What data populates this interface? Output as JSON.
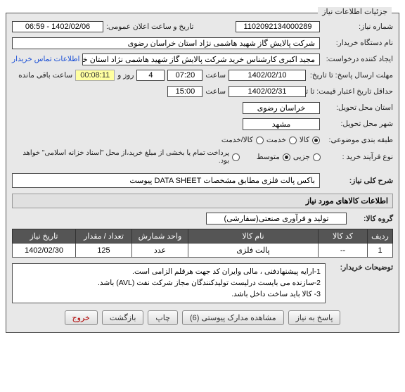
{
  "panel": {
    "title": "جزئیات اطلاعات نیاز"
  },
  "fields": {
    "need_no_label": "شماره نیاز:",
    "need_no": "1102092134000289",
    "announce_label": "تاریخ و ساعت اعلان عمومی:",
    "announce_value": "1402/02/06 - 06:59",
    "buyer_org_label": "نام دستگاه خریدار:",
    "buyer_org": "شرکت پالایش گاز شهید هاشمی نژاد   استان خراسان رضوی",
    "requester_label": "ایجاد کننده درخواست:",
    "requester": "مجید اکبری کارشناس خرید شرکت پالایش گاز شهید هاشمی نژاد  استان خرا",
    "contact_link": "اطلاعات تماس خریدار",
    "deadline_label": "مهلت ارسال پاسخ: تا تاریخ:",
    "deadline_date": "1402/02/10",
    "time_label": "ساعت",
    "deadline_time": "07:20",
    "day_and": "روز و",
    "days_left": "4",
    "countdown": "00:08:11",
    "remaining": "ساعت باقی مانده",
    "validity_label": "حداقل تاریخ اعتبار قیمت: تا تاریخ:",
    "validity_date": "1402/02/31",
    "validity_time": "15:00",
    "province_label": "استان محل تحویل:",
    "province": "خراسان رضوی",
    "city_label": "شهر محل تحویل:",
    "city": "مشهد",
    "category_label": "طبقه بندی موضوعی:",
    "cat_goods": "کالا",
    "cat_service": "خدمت",
    "cat_both": "کالا/خدمت",
    "purchase_type_label": "نوع فرآیند خرید :",
    "pt_minor": "جزیی",
    "pt_medium": "متوسط",
    "pay_note": "پرداخت تمام یا بخشی از مبلغ خرید،از محل \"اسناد خزانه اسلامی\" خواهد بود."
  },
  "desc": {
    "title_label": "شرح کلی نیاز:",
    "title": "باکس پالت فلزی مطابق مشخصات DATA SHEET پیوست"
  },
  "goods_section": {
    "header": "اطلاعات کالاهای مورد نیاز",
    "group_label": "گروه کالا:",
    "group_value": "تولید و فرآوری صنعتی(سفارشی)"
  },
  "table": {
    "headers": [
      "ردیف",
      "کد کالا",
      "نام کالا",
      "واحد شمارش",
      "تعداد / مقدار",
      "تاریخ نیاز"
    ],
    "rows": [
      {
        "idx": "1",
        "code": "--",
        "name": "پالت فلزی",
        "unit": "عدد",
        "qty": "125",
        "date": "1402/02/30"
      }
    ]
  },
  "buyer_notes": {
    "label": "توضیحات خریدار:",
    "text": "1-ارایه پیشنهادفنی ، مالی وایران کد جهت هرقلم الزامی است.\n2-سازنده می بایست درلیست تولیدکنندگان مجاز شرکت نفت (AVL)  باشد.\n3- کالا باید ساخت  داخل  باشد."
  },
  "buttons": {
    "reply": "پاسخ به نیاز",
    "attachments": "مشاهده مدارک پیوستی (6)",
    "print": "چاپ",
    "back": "بازگشت",
    "exit": "خروج"
  }
}
